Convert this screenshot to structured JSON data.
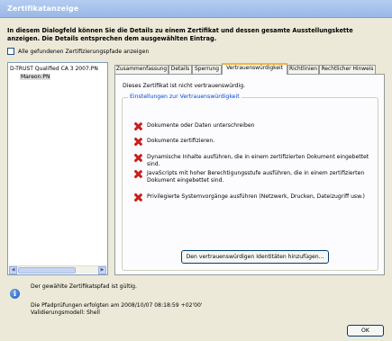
{
  "window": {
    "title": "Zertifikatanzeige"
  },
  "intro": "In diesem Dialogfeld können Sie die Details zu einem Zertifikat und dessen gesamte Ausstellungskette anzeigen. Die Details entsprechen dem ausgewählten Eintrag.",
  "show_all_paths": {
    "label": "Alle gefundenen Zertifizierungspfade anzeigen",
    "checked": false
  },
  "tree": [
    {
      "label": "D-TRUST Qualified CA 3 2007:PN",
      "level": 0,
      "selected": false
    },
    {
      "label": "Mareon:PN",
      "level": 1,
      "selected": true
    }
  ],
  "tabs": [
    {
      "label": "Zusammenfassung",
      "active": false
    },
    {
      "label": "Details",
      "active": false
    },
    {
      "label": "Sperrung",
      "active": false
    },
    {
      "label": "Vertrauenswürdigkeit",
      "active": true
    },
    {
      "label": "Richtlinien",
      "active": false
    },
    {
      "label": "Rechtlicher Hinweis",
      "active": false
    }
  ],
  "trust": {
    "status_text": "Dieses Zertifikat ist nicht vertrauenswürdig.",
    "group_title": "Einstellungen zur Vertrauenswürdigkeit",
    "permissions": [
      "Dokumente oder Daten unterschreiben",
      "Dokumente zertifizieren.",
      "Dynamische Inhalte ausführen, die in einem zertifizierten Dokument eingebettet sind.",
      "JavaScripts mit hoher Berechtigungsstufe ausführen, die in einem zertifizierten Dokument eingebettet sind.",
      "Privilegierte Systemvorgänge ausführen (Netzwerk, Drucken, Dateizugriff usw.)"
    ],
    "add_button": "Den vertrauenswürdigen Identitäten hinzufügen..."
  },
  "status": {
    "line1": "Der gewählte Zertifikatspfad ist gültig.",
    "line2": "Die Pfadprüfungen erfolgten am 2008/10/07 08:18:59 +02'00'",
    "line3": "Validierungsmodell: Shell"
  },
  "ok_button": "OK",
  "colors": {
    "titlebar": "#99b7e6",
    "dialog_bg": "#ece9d8",
    "active_tab_accent": "#f4b43a",
    "group_title": "#0046d5",
    "deny_icon": "#c8201f"
  }
}
